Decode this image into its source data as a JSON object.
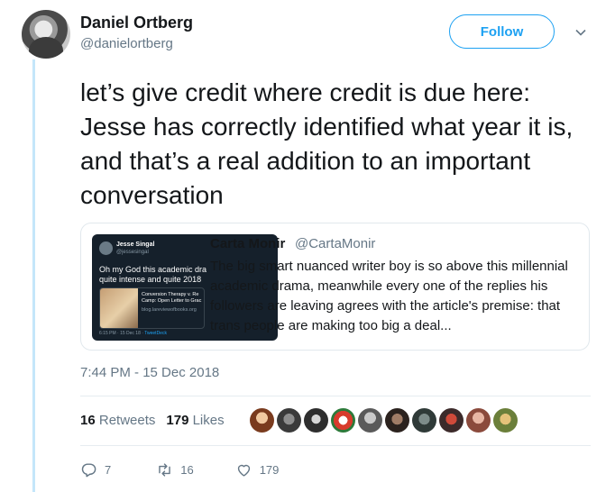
{
  "author": {
    "name": "Daniel Ortberg",
    "handle": "@danielortberg"
  },
  "follow_button": {
    "label": "Follow"
  },
  "tweet": {
    "text": "let’s give credit where credit is due here: Jesse has correctly identified what year it is, and that’s a real addition to an important conversation",
    "timestamp": "7:44 PM - 15 Dec 2018"
  },
  "quote": {
    "name": "Carta Monir",
    "handle": "@CartaMonir",
    "text": "The big smart nuanced writer boy is so above this millennial academic drama, meanwhile every one of the replies his followers are leaving agrees with the article's premise: that trans people are making too big a deal...",
    "thumbnail": {
      "name": "Jesse Singal",
      "handle": "@jessesingal",
      "text_line1": "Oh my God this academic dra",
      "text_line2": "quite intense and quite 2018",
      "card_title_line1": "Conversion Therapy v. Re",
      "card_title_line2": "Camp: Open Letter to Grac",
      "card_url": "blog.lareviewofbooks.org",
      "time": "6:15 PM · 15 Dec 18 ·",
      "client": "TweetDeck"
    }
  },
  "stats": {
    "retweets_count": "16",
    "retweets_label": "Retweets",
    "likes_count": "179",
    "likes_label": "Likes"
  },
  "actions": {
    "reply_count": "7",
    "retweet_count": "16",
    "like_count": "179"
  },
  "colors": {
    "accent": "#1da1f2",
    "retweet": "#17bf63",
    "muted": "#657786",
    "thread_line": "#c4e6fa"
  }
}
